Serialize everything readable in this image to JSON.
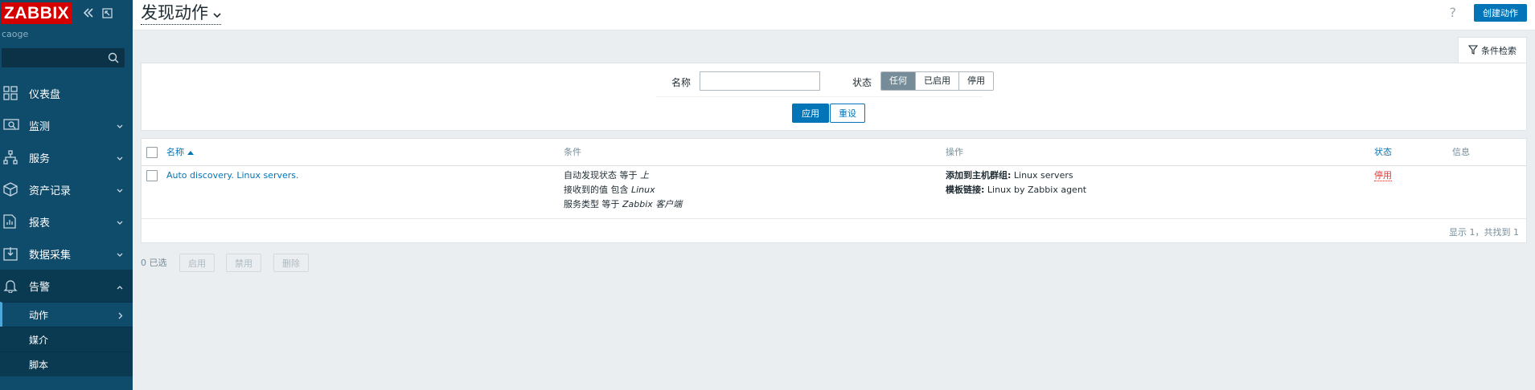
{
  "sidebar": {
    "logo": "ZABBIX",
    "server_name": "caoge",
    "search_placeholder": "",
    "items": [
      {
        "label": "仪表盘"
      },
      {
        "label": "监测"
      },
      {
        "label": "服务"
      },
      {
        "label": "资产记录"
      },
      {
        "label": "报表"
      },
      {
        "label": "数据采集"
      },
      {
        "label": "告警"
      }
    ],
    "submenu": [
      {
        "label": "动作"
      },
      {
        "label": "媒介"
      },
      {
        "label": "脚本"
      }
    ]
  },
  "header": {
    "title": "发现动作",
    "help": "?",
    "create_label": "创建动作"
  },
  "filter": {
    "tab_label": "条件检索",
    "name_label": "名称",
    "name_value": "",
    "status_label": "状态",
    "status_options": [
      "任何",
      "已启用",
      "停用"
    ],
    "status_selected": "任何",
    "apply_label": "应用",
    "reset_label": "重设"
  },
  "table": {
    "headers": {
      "name": "名称",
      "conditions": "条件",
      "operations": "操作",
      "status": "状态",
      "info": "信息"
    },
    "sort": "名称 ascending",
    "rows": [
      {
        "name": "Auto discovery. Linux servers.",
        "conditions": [
          {
            "text": "自动发现状态 等于 ",
            "value": "上"
          },
          {
            "text": "接收到的值 包含 ",
            "value": "Linux"
          },
          {
            "text": "服务类型 等于 ",
            "value": "Zabbix 客户端"
          }
        ],
        "operations": [
          {
            "label": "添加到主机群组:",
            "value": " Linux servers"
          },
          {
            "label": "模板链接:",
            "value": " Linux by Zabbix agent"
          }
        ],
        "status": "停用",
        "info": ""
      }
    ],
    "footer": "显示 1，共找到 1"
  },
  "bulk": {
    "selected": "0 已选",
    "enable": "启用",
    "disable": "禁用",
    "delete": "删除"
  },
  "colors": {
    "sidebar": "#0f4b6b",
    "accent": "#0275b8",
    "danger": "#e33734"
  }
}
